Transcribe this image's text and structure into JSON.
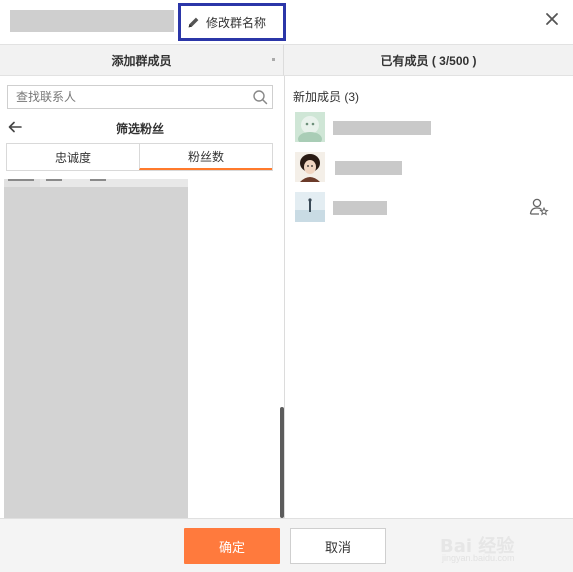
{
  "window": {
    "rename_label": "修改群名称",
    "close_icon": "close-icon",
    "edit_icon": "pencil-icon"
  },
  "left_panel": {
    "header": "添加群成员",
    "search_placeholder": "查找联系人",
    "filter_title": "筛选粉丝",
    "tabs": [
      {
        "label": "忠诚度",
        "active": false
      },
      {
        "label": "粉丝数",
        "active": true
      }
    ]
  },
  "right_panel": {
    "header": "已有成员 ( 3/500 )",
    "group_label": "新加成员 (3)",
    "members": [
      {
        "avatar": "avatar-1"
      },
      {
        "avatar": "avatar-2"
      },
      {
        "avatar": "avatar-3",
        "has_admin_icon": true
      }
    ]
  },
  "footer": {
    "ok_label": "确定",
    "cancel_label": "取消"
  },
  "watermark": {
    "text": "Bai 经验",
    "sub": "jingyan.baidu.com"
  },
  "colors": {
    "accent": "#ff7a3d",
    "highlight_box": "#2b36a8",
    "tab_underline": "#ff7a2c"
  }
}
